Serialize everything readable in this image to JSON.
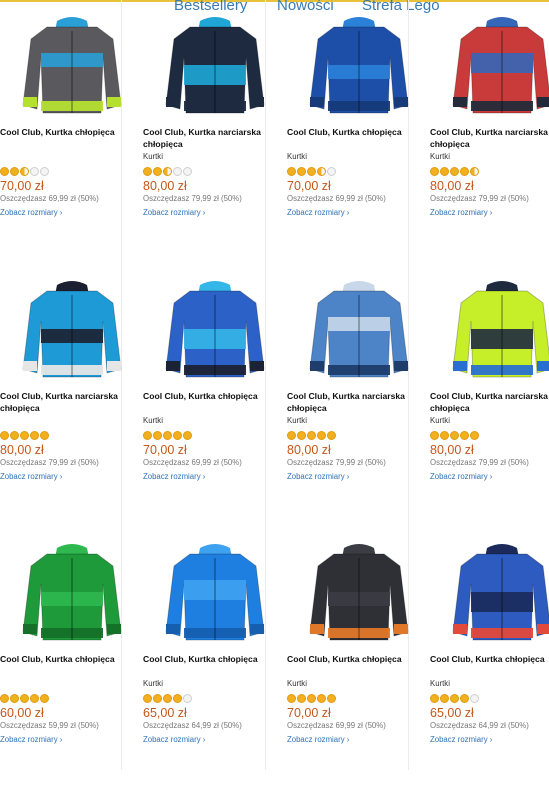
{
  "nav": {
    "bestsellery": "Bestsellery",
    "nowosci": "Nowości",
    "strefa_lego": "Strefa Lego"
  },
  "colors": {
    "price": "#c4571c",
    "link": "#2f73b8",
    "star": "#f2b01e",
    "nav_accent": "#e9c23a"
  },
  "products": [
    {
      "title": "Cool Club, Kurtka chłopięca",
      "category": "",
      "rating": 2.5,
      "price": "70,00 zł",
      "save": "Oszczędzasz 69,99 zł (50%)",
      "link": "Zobacz rozmiary ›",
      "jacket": {
        "body": "#5a5a5e",
        "accent": "#2a9fd6",
        "trim": "#b6e030"
      }
    },
    {
      "title": "Cool Club, Kurtka narciarska chłopięca",
      "category": "Kurtki",
      "rating": 2.5,
      "price": "80,00 zł",
      "save": "Oszczędzasz 79,99 zł (50%)",
      "link": "Zobacz rozmiary ›",
      "jacket": {
        "body": "#1d2a40",
        "accent": "#1fa6d6",
        "trim": "#1d2a40"
      }
    },
    {
      "title": "Cool Club, Kurtka chłopięca",
      "category": "Kurtki",
      "rating": 3.5,
      "price": "70,00 zł",
      "save": "Oszczędzasz 69,99 zł (50%)",
      "link": "Zobacz rozmiary ›",
      "jacket": {
        "body": "#1e4fa8",
        "accent": "#2b80d8",
        "trim": "#163a7a"
      }
    },
    {
      "title": "Cool Club, Kurtka narciarska chłopięca",
      "category": "Kurtki",
      "rating": 4.5,
      "price": "80,00 zł",
      "save": "Oszczędzasz 79,99 zł (50%)",
      "link": "Zobacz rozmiary ›",
      "jacket": {
        "body": "#c93a3a",
        "accent": "#3566b8",
        "trim": "#232a3a"
      }
    },
    {
      "title": "Cool Club, Kurtka narciarska chłopięca",
      "category": "",
      "rating": 5,
      "price": "80,00 zł",
      "save": "Oszczędzasz 79,99 zł (50%)",
      "link": "Zobacz rozmiary ›",
      "jacket": {
        "body": "#1e9ad6",
        "accent": "#1b2030",
        "trim": "#e6e6e6"
      }
    },
    {
      "title": "Cool Club, Kurtka chłopięca",
      "category": "Kurtki",
      "rating": 5,
      "price": "70,00 zł",
      "save": "Oszczędzasz 69,99 zł (50%)",
      "link": "Zobacz rozmiary ›",
      "jacket": {
        "body": "#2c62c8",
        "accent": "#35b6e8",
        "trim": "#1b2235"
      }
    },
    {
      "title": "Cool Club, Kurtka narciarska chłopięca",
      "category": "Kurtki",
      "rating": 5,
      "price": "80,00 zł",
      "save": "Oszczędzasz 79,99 zł (50%)",
      "link": "Zobacz rozmiary ›",
      "jacket": {
        "body": "#4d84c8",
        "accent": "#c8d8ea",
        "trim": "#1e3d6b"
      }
    },
    {
      "title": "Cool Club, Kurtka narciarska chłopięca",
      "category": "Kurtki",
      "rating": 5,
      "price": "80,00 zł",
      "save": "Oszczędzasz 79,99 zł (50%)",
      "link": "Zobacz rozmiary ›",
      "jacket": {
        "body": "#c6ef2a",
        "accent": "#1e2a3e",
        "trim": "#2a6fd0"
      }
    },
    {
      "title": "Cool Club, Kurtka chłopięca",
      "category": "",
      "rating": 5,
      "price": "60,00 zł",
      "save": "Oszczędzasz 59,99 zł (50%)",
      "link": "Zobacz rozmiary ›",
      "jacket": {
        "body": "#1f9a3a",
        "accent": "#2fb850",
        "trim": "#157028"
      }
    },
    {
      "title": "Cool Club, Kurtka chłopięca",
      "category": "Kurtki",
      "rating": 4,
      "price": "65,00 zł",
      "save": "Oszczędzasz 64,99 zł (50%)",
      "link": "Zobacz rozmiary ›",
      "jacket": {
        "body": "#1f7fe0",
        "accent": "#3ea2f0",
        "trim": "#165fb0"
      }
    },
    {
      "title": "Cool Club, Kurtka chłopięca",
      "category": "Kurtki",
      "rating": 5,
      "price": "70,00 zł",
      "save": "Oszczędzasz 69,99 zł (50%)",
      "link": "Zobacz rozmiary ›",
      "jacket": {
        "body": "#2f3036",
        "accent": "#3b3c44",
        "trim": "#e0782a"
      }
    },
    {
      "title": "Cool Club, Kurtka chłopięca",
      "category": "Kurtki",
      "rating": 4,
      "price": "65,00 zł",
      "save": "Oszczędzasz 64,99 zł (50%)",
      "link": "Zobacz rozmiary ›",
      "jacket": {
        "body": "#2d5bbf",
        "accent": "#1b2a5a",
        "trim": "#e24a3a"
      }
    }
  ]
}
